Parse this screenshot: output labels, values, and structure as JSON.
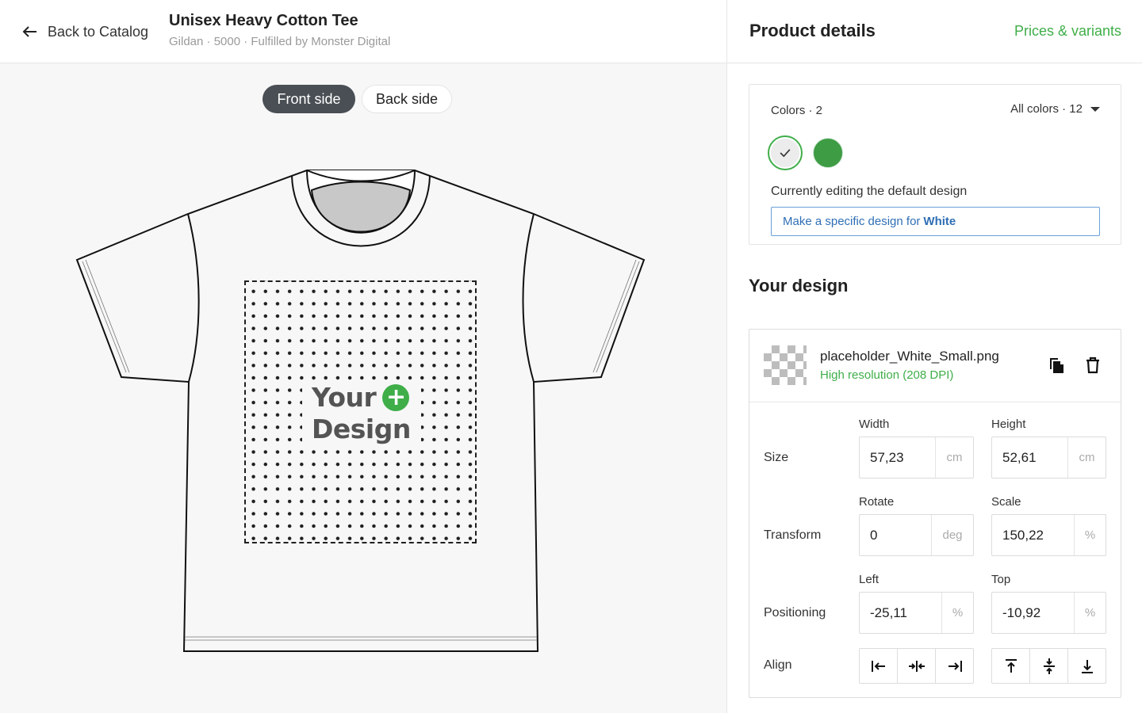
{
  "header": {
    "back_label": "Back to Catalog",
    "product_title": "Unisex Heavy Cotton Tee",
    "product_subtitle": "Gildan · 5000 · Fulfilled by Monster Digital"
  },
  "canvas": {
    "front_label": "Front side",
    "back_label": "Back side",
    "active_side": "Front side",
    "design_line1": "Your",
    "design_line2": "Design",
    "design_plus": "+"
  },
  "panel": {
    "title": "Product details",
    "prices_link": "Prices & variants",
    "colors": {
      "label": "Colors · 2",
      "all_colors": "All colors · 12",
      "swatches": [
        {
          "name": "White",
          "hex": "#ececec",
          "selected": true
        },
        {
          "name": "Green",
          "hex": "#3d9c44",
          "selected": false
        }
      ],
      "editing_text": "Currently editing the default design",
      "specific_prefix": "Make a specific design for",
      "specific_color": "White"
    },
    "your_design_title": "Your design",
    "file": {
      "name": "placeholder_White_Small.png",
      "resolution": "High resolution (208 DPI)"
    },
    "size": {
      "label": "Size",
      "width_label": "Width",
      "width_value": "57,23",
      "width_unit": "cm",
      "height_label": "Height",
      "height_value": "52,61",
      "height_unit": "cm"
    },
    "transform": {
      "label": "Transform",
      "rotate_label": "Rotate",
      "rotate_value": "0",
      "rotate_unit": "deg",
      "scale_label": "Scale",
      "scale_value": "150,22",
      "scale_unit": "%"
    },
    "positioning": {
      "label": "Positioning",
      "left_label": "Left",
      "left_value": "-25,11",
      "left_unit": "%",
      "top_label": "Top",
      "top_value": "-10,92",
      "top_unit": "%"
    },
    "align": {
      "label": "Align"
    }
  },
  "colors": {
    "accent_green": "#3fae49",
    "link_blue": "#2f6fb5",
    "toggle_dark": "#4a4f55"
  }
}
